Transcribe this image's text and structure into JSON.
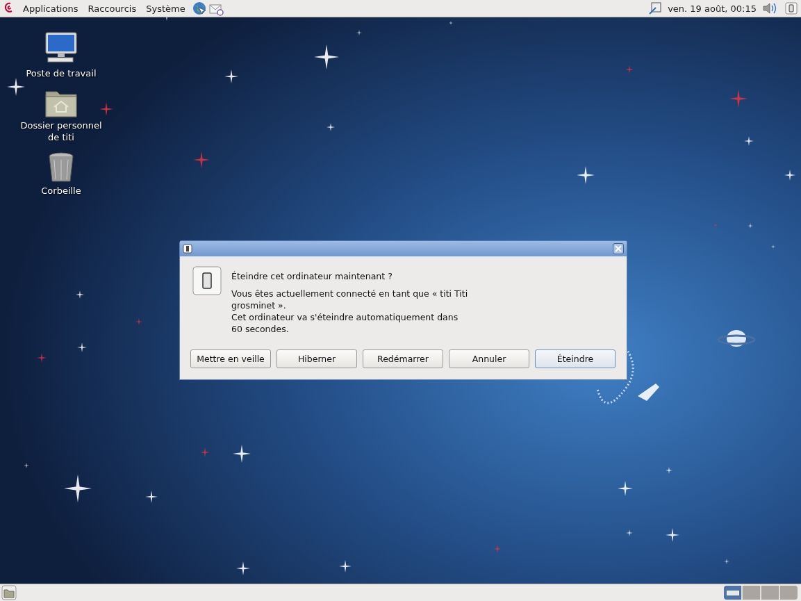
{
  "top_panel": {
    "menus": [
      {
        "label": "Applications"
      },
      {
        "label": "Raccourcis"
      },
      {
        "label": "Système"
      }
    ],
    "clock": "ven. 19 août, 00:15"
  },
  "desktop_icons": [
    {
      "label": "Poste de travail",
      "kind": "computer"
    },
    {
      "label": "Dossier personnel de titi",
      "kind": "home"
    },
    {
      "label": "Corbeille",
      "kind": "trash"
    }
  ],
  "dialog": {
    "heading": "Éteindre cet ordinateur maintenant ?",
    "message_lines": [
      "Vous êtes actuellement connecté en tant que « titi Titi",
      "grosminet ».",
      "Cet ordinateur va s'éteindre automatiquement dans",
      "60 secondes."
    ],
    "buttons": [
      {
        "label": "Mettre en veille",
        "selected": false
      },
      {
        "label": "Hiberner",
        "selected": false
      },
      {
        "label": "Redémarrer",
        "selected": false
      },
      {
        "label": "Annuler",
        "selected": false
      },
      {
        "label": "Éteindre",
        "selected": true
      }
    ]
  },
  "bottom_panel": {
    "workspaces": [
      {
        "selected": true
      },
      {
        "selected": false
      },
      {
        "selected": false
      },
      {
        "selected": false
      }
    ]
  }
}
